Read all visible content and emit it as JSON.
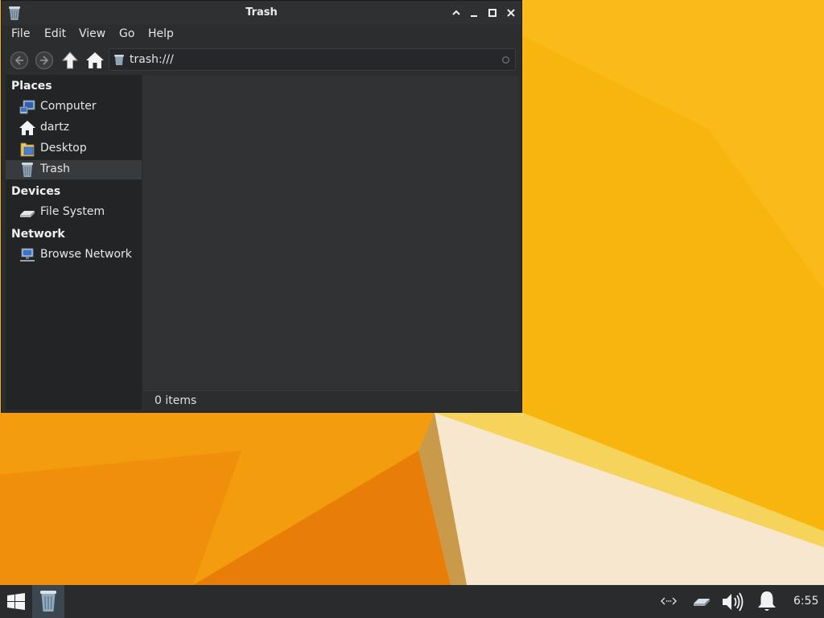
{
  "window": {
    "title": "Trash",
    "menu": [
      "File",
      "Edit",
      "View",
      "Go",
      "Help"
    ],
    "address": "trash:///",
    "status": "0 items"
  },
  "sidebar": {
    "places_heading": "Places",
    "places": [
      {
        "label": "Computer",
        "icon": "computer-icon"
      },
      {
        "label": "dartz",
        "icon": "home-folder-icon"
      },
      {
        "label": "Desktop",
        "icon": "desktop-folder-icon"
      },
      {
        "label": "Trash",
        "icon": "trash-icon",
        "active": true
      }
    ],
    "devices_heading": "Devices",
    "devices": [
      {
        "label": "File System",
        "icon": "drive-icon"
      }
    ],
    "network_heading": "Network",
    "network": [
      {
        "label": "Browse Network",
        "icon": "network-icon"
      }
    ]
  },
  "taskbar": {
    "clock": "6:55",
    "tray_icons": [
      "network-status-icon",
      "network-connection-icon",
      "volume-icon",
      "notification-bell-icon"
    ]
  },
  "colors": {
    "desktop_orange": "#f7b20a",
    "window_bg": "#2b2d2e",
    "taskbar_bg": "#2a2b2c"
  }
}
